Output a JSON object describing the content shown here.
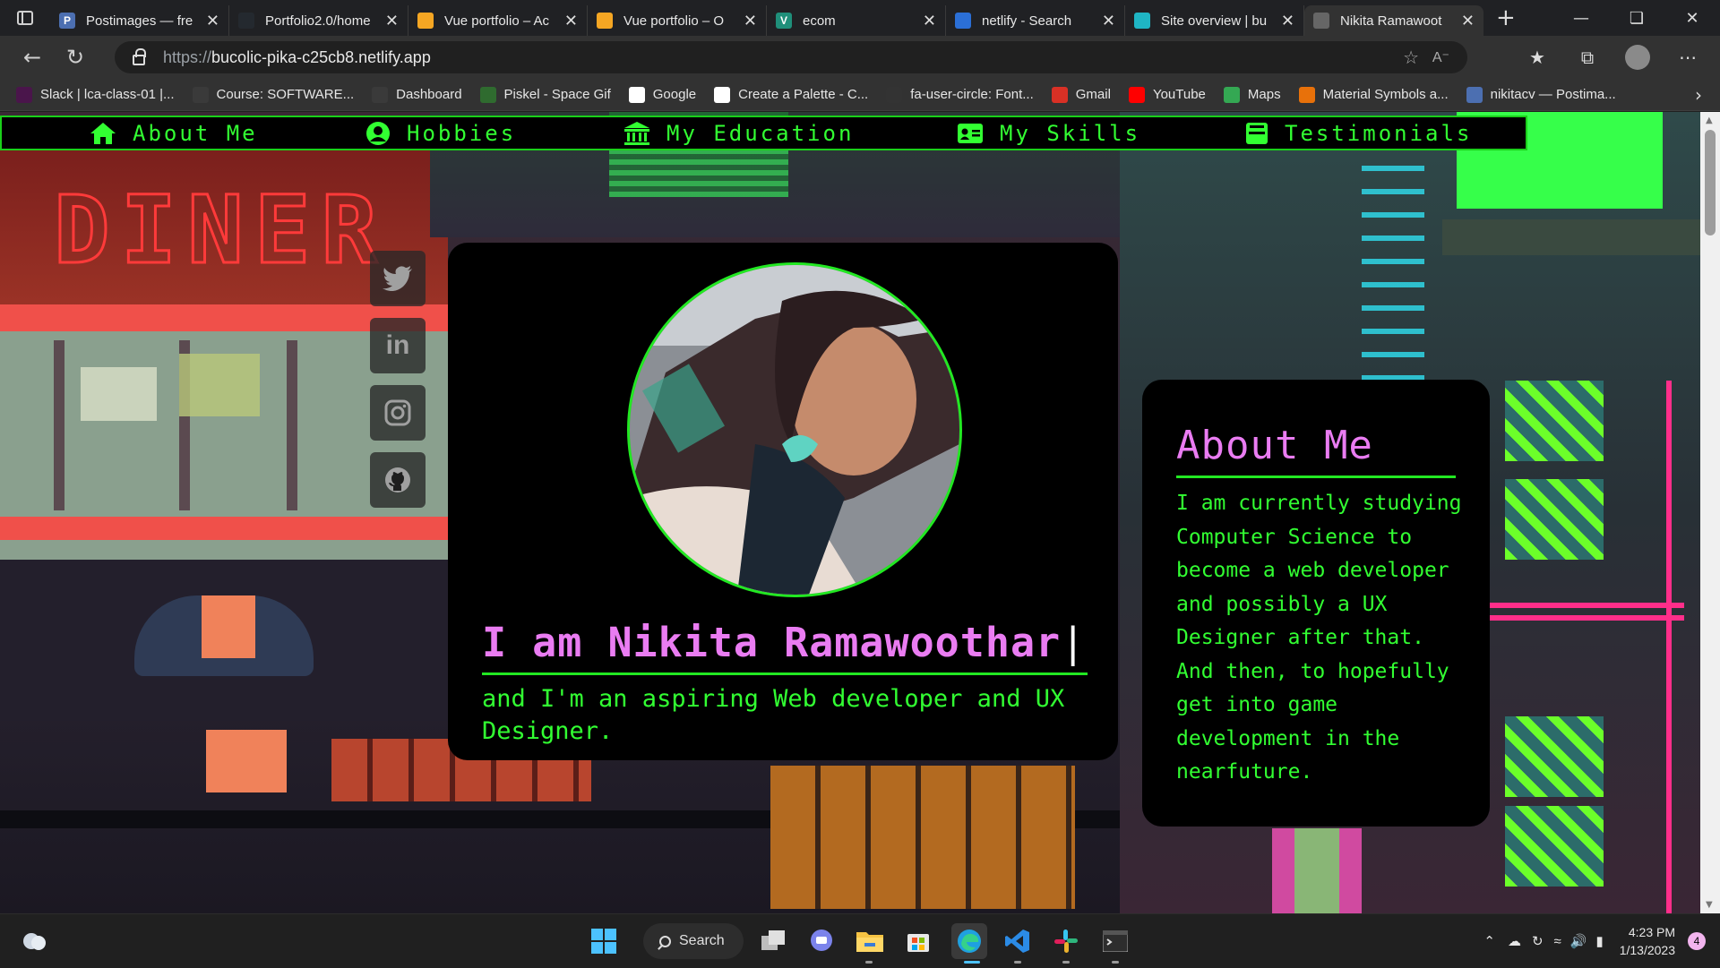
{
  "browser": {
    "tabs": [
      {
        "title": "Postimages — fre",
        "icon": "postimages-icon",
        "color": "#4c6fb1",
        "glyph": "P"
      },
      {
        "title": "Portfolio2.0/home",
        "icon": "github-icon",
        "color": "#24292f",
        "glyph": ""
      },
      {
        "title": "Vue portfolio – Ac",
        "icon": "firebase-icon",
        "color": "#f5a623",
        "glyph": ""
      },
      {
        "title": "Vue portfolio – O",
        "icon": "firebase-icon",
        "color": "#f5a623",
        "glyph": ""
      },
      {
        "title": "ecom",
        "icon": "vercel-icon",
        "color": "#1f8f7a",
        "glyph": "V"
      },
      {
        "title": "netlify - Search",
        "icon": "bing-search-icon",
        "color": "#2b6fd6",
        "glyph": ""
      },
      {
        "title": "Site overview | bu",
        "icon": "netlify-icon",
        "color": "#1fb5c4",
        "glyph": ""
      },
      {
        "title": "Nikita Ramawoot",
        "icon": "page-icon",
        "color": "#666666",
        "glyph": ""
      }
    ],
    "active_tab_index": 7,
    "url_protocol": "https://",
    "url_host": "bucolic-pika-c25cb8.netlify.app",
    "bookmarks": [
      {
        "label": "Slack | lca-class-01 |...",
        "icon": "slack-icon",
        "color": "#4a154b"
      },
      {
        "label": "Course: SOFTWARE...",
        "icon": "course-icon",
        "color": "#3a3a3a"
      },
      {
        "label": "Dashboard",
        "icon": "dashboard-icon",
        "color": "#3a3a3a"
      },
      {
        "label": "Piskel - Space Gif",
        "icon": "piskel-icon",
        "color": "#2f6b2f"
      },
      {
        "label": "Google",
        "icon": "google-icon",
        "color": "#ffffff"
      },
      {
        "label": "Create a Palette - C...",
        "icon": "coolors-icon",
        "color": "#ffffff"
      },
      {
        "label": "fa-user-circle: Font...",
        "icon": "fontawesome-flag-icon",
        "color": "#333333"
      },
      {
        "label": "Gmail",
        "icon": "gmail-icon",
        "color": "#d93025"
      },
      {
        "label": "YouTube",
        "icon": "youtube-icon",
        "color": "#ff0000"
      },
      {
        "label": "Maps",
        "icon": "maps-icon",
        "color": "#34a853"
      },
      {
        "label": "Material Symbols a...",
        "icon": "material-symbols-icon",
        "color": "#e8710a"
      },
      {
        "label": "nikitacv — Postima...",
        "icon": "postimages-icon",
        "color": "#4c6fb1"
      }
    ]
  },
  "nav": {
    "items": [
      {
        "label": "About Me",
        "icon": "home-icon"
      },
      {
        "label": "Hobbies",
        "icon": "user-circle-icon"
      },
      {
        "label": "My Education",
        "icon": "building-columns-icon"
      },
      {
        "label": "My Skills",
        "icon": "id-card-icon"
      },
      {
        "label": "Testimonials",
        "icon": "inbox-icon"
      }
    ],
    "color": "#32ff32"
  },
  "social": [
    "twitter-icon",
    "linkedin-icon",
    "instagram-icon",
    "github-icon"
  ],
  "hero": {
    "heading": "I am Nikita Ramawoothar",
    "cursor": "|",
    "tagline": "and I'm an aspiring Web developer and UX Designer.",
    "photo_alt": "profile-photo",
    "heading_color": "#ea7cf2"
  },
  "about": {
    "title": "About Me",
    "body": "I am currently studying Computer Science to become a web developer and possibly a UX Designer after that. And then, to hopefully get into game development in the nearfuture."
  },
  "taskbar": {
    "search_label": "Search",
    "time": "4:23 PM",
    "date": "1/13/2023",
    "notifications": "4"
  }
}
